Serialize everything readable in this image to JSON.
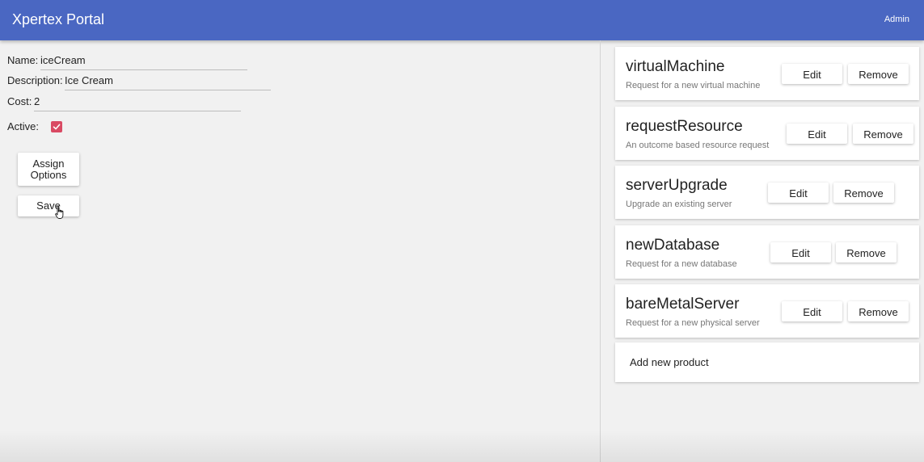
{
  "header": {
    "title": "Xpertex Portal",
    "user": "Admin"
  },
  "form": {
    "name_label": "Name:",
    "name_value": "iceCream",
    "description_label": "Description:",
    "description_value": "Ice Cream",
    "cost_label": "Cost:",
    "cost_value": "2",
    "active_label": "Active:",
    "active_checked": true,
    "assign_options_label": "Assign Options",
    "save_label": "Save"
  },
  "products": [
    {
      "name": "virtualMachine",
      "description": "Request for a new virtual machine",
      "edit_label": "Edit",
      "remove_label": "Remove"
    },
    {
      "name": "requestResource",
      "description": "An outcome based resource request",
      "edit_label": "Edit",
      "remove_label": "Remove"
    },
    {
      "name": "serverUpgrade",
      "description": "Upgrade an existing server",
      "edit_label": "Edit",
      "remove_label": "Remove"
    },
    {
      "name": "newDatabase",
      "description": "Request for a new database",
      "edit_label": "Edit",
      "remove_label": "Remove"
    },
    {
      "name": "bareMetalServer",
      "description": "Request for a new physical server",
      "edit_label": "Edit",
      "remove_label": "Remove"
    }
  ],
  "add_product_label": "Add new product",
  "colors": {
    "header_bg": "#4a67c2",
    "checkbox_accent": "#d94a63"
  },
  "icons": {
    "checkbox": "checkmark-icon",
    "cursor": "hand-pointer-icon"
  }
}
